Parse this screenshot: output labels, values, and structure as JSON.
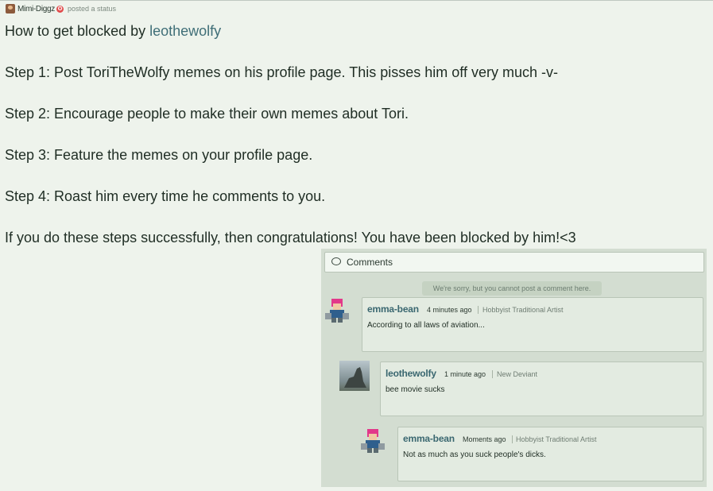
{
  "header": {
    "username": "Mimi-Diggz",
    "badge_symbol": "✪",
    "action": "posted a status"
  },
  "status": {
    "title_prefix": "How to get blocked by ",
    "title_link": "leothewolfy",
    "lines": [
      "Step 1: Post ToriTheWolfy memes on his profile page. This pisses him off very much -v-",
      "Step 2: Encourage people to make their own memes about Tori.",
      "Step 3: Feature the memes on your profile page.",
      "Step 4: Roast him every time he comments to you.",
      "If you do these steps successfully, then congratulations! You have been blocked by him!<3"
    ]
  },
  "comments_panel": {
    "title": "Comments",
    "notice": "We're sorry, but you cannot post a comment here.",
    "comments": [
      {
        "name": "emma-bean",
        "time": "4 minutes ago",
        "role": "Hobbyist Traditional Artist",
        "text": "According to all laws of aviation..."
      },
      {
        "name": "leothewolfy",
        "time": "1 minute ago",
        "role": "New Deviant",
        "text": "bee movie sucks"
      },
      {
        "name": "emma-bean",
        "time": "Moments ago",
        "role": "Hobbyist Traditional Artist",
        "text": "Not as much as you suck people's dicks."
      }
    ]
  },
  "colors": {
    "background": "#eef3ec",
    "link": "#3f6e77",
    "panel": "#d3ddd1"
  }
}
